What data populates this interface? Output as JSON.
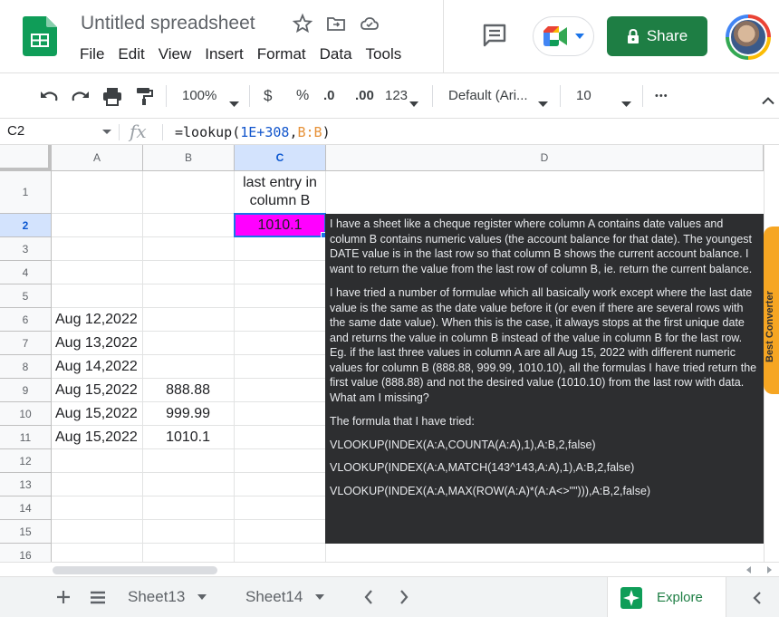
{
  "header": {
    "doc_title": "Untitled spreadsheet",
    "menu": [
      "File",
      "Edit",
      "View",
      "Insert",
      "Format",
      "Data",
      "Tools"
    ],
    "share_label": "Share"
  },
  "toolbar": {
    "zoom": "100%",
    "currency": "$",
    "percent": "%",
    "decrease_decimals": ".0",
    "increase_decimals": ".00",
    "more_formats": "123",
    "font": "Default (Ari...",
    "font_size": "10",
    "more": "•••"
  },
  "formula_bar": {
    "name_box": "C2",
    "fx": "fx",
    "formula_prefix": "=lookup(",
    "formula_num": "1E+308",
    "formula_comma": ",",
    "formula_range": "B:B",
    "formula_suffix": ")"
  },
  "grid": {
    "columns": [
      "A",
      "B",
      "C",
      "D"
    ],
    "rows": [
      "1",
      "2",
      "3",
      "4",
      "5",
      "6",
      "7",
      "8",
      "9",
      "10",
      "11",
      "12",
      "13",
      "14",
      "15",
      "16"
    ],
    "c1": "last entry in column B",
    "c2": "1010.1",
    "a6": "Aug 12,2022",
    "a7": "Aug 13,2022",
    "a8": "Aug 14,2022",
    "a9": "Aug 15,2022",
    "a10": "Aug 15,2022",
    "a11": "Aug 15,2022",
    "b9": "888.88",
    "b10": "999.99",
    "b11": "1010.1"
  },
  "note": {
    "p1": "I have a sheet like a cheque register where column A contains date values and column B contains numeric values (the account balance for that date). The youngest DATE value is in the last row so that column B shows the current account balance. I want to return the value from the last row of column B, ie. return the current balance.",
    "p2": "I have tried a number of formulae which all basically work except where the last date value is the same as the date value before it (or even if there are several rows with the same date value). When this is the case, it always stops at the first unique date and returns the value in column B instead of the value in column B for the last row. Eg. if the last three values in column A are all Aug 15, 2022 with different numeric values for column B (888.88, 999.99, 1010.10), all the formulas I have tried return the first value (888.88) and not the desired value (1010.10) from the last row with data. What am I missing?",
    "p3": "The formula that I have tried:",
    "f1": "VLOOKUP(INDEX(A:A,COUNTA(A:A),1),A:B,2,false)",
    "f2": "VLOOKUP(INDEX(A:A,MATCH(143^143,A:A),1),A:B,2,false)",
    "f3": "VLOOKUP(INDEX(A:A,MAX(ROW(A:A)*(A:A<>\"\"))),A:B,2,false)"
  },
  "addon": {
    "label": "Best Converter"
  },
  "bottom": {
    "sheets": [
      "Sheet13",
      "Sheet14"
    ],
    "explore_label": "Explore"
  },
  "colors": {
    "share_green": "#1e7e44",
    "selected_cell_fill": "#ff00ff",
    "selection_blue": "#1a73e8",
    "overlay_bg": "#2d2e30",
    "addon_orange": "#f6a623"
  }
}
